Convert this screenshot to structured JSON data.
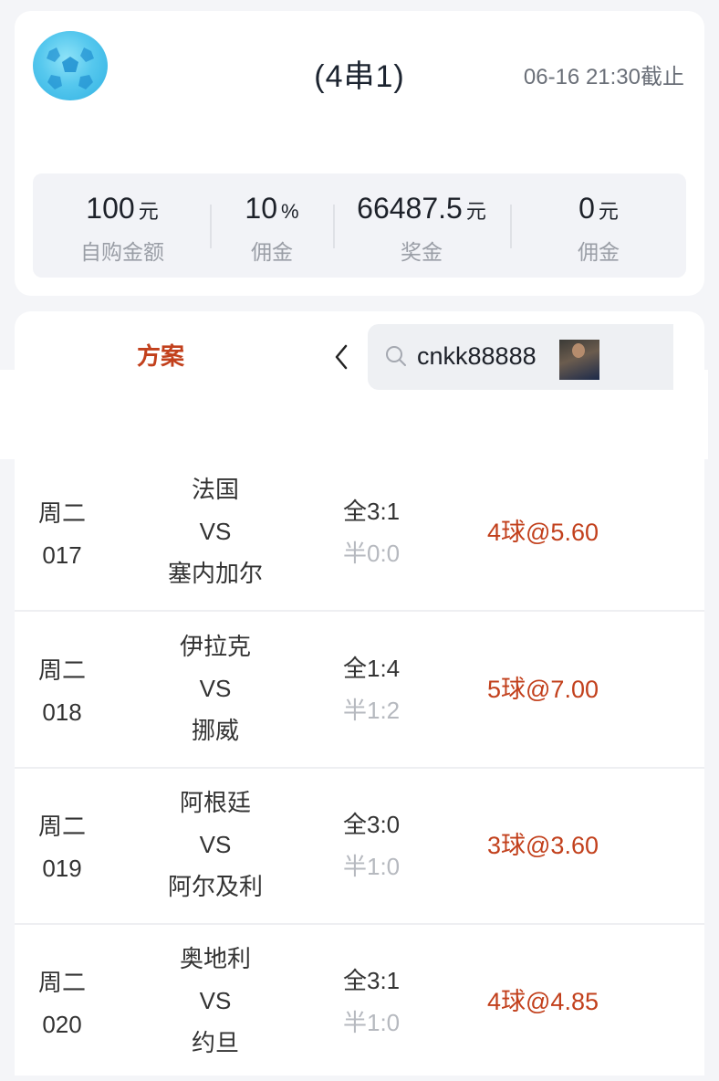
{
  "header": {
    "title": "(4串1)",
    "deadline": "06-16 21:30截止"
  },
  "stats": [
    {
      "value": "100",
      "unit": "元",
      "label": "自购金额"
    },
    {
      "value": "10",
      "unit": "%",
      "label": "佣金"
    },
    {
      "value": "66487.5",
      "unit": "元",
      "label": "奖金"
    },
    {
      "value": "0",
      "unit": "元",
      "label": "佣金"
    }
  ],
  "tabs": {
    "plan_label": "方案"
  },
  "search": {
    "text": "cnkk88888"
  },
  "matches": [
    {
      "day": "周二",
      "no": "017",
      "home": "法国",
      "vs": "VS",
      "away": "塞内加尔",
      "full": "全3:1",
      "half": "半0:0",
      "pick": "4球@5.60"
    },
    {
      "day": "周二",
      "no": "018",
      "home": "伊拉克",
      "vs": "VS",
      "away": "挪威",
      "full": "全1:4",
      "half": "半1:2",
      "pick": "5球@7.00"
    },
    {
      "day": "周二",
      "no": "019",
      "home": "阿根廷",
      "vs": "VS",
      "away": "阿尔及利",
      "full": "全3:0",
      "half": "半1:0",
      "pick": "3球@3.60"
    },
    {
      "day": "周二",
      "no": "020",
      "home": "奥地利",
      "vs": "VS",
      "away": "约旦",
      "full": "全3:1",
      "half": "半1:0",
      "pick": "4球@4.85"
    }
  ]
}
